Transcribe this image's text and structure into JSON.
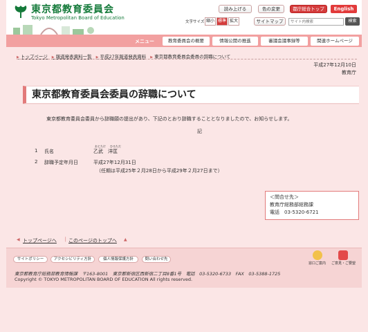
{
  "header": {
    "logo_jp": "東京都教育委員会",
    "logo_en": "Tokyo Metropolitan Board of Education",
    "read_aloud": "読み上げる",
    "color_change": "色の変更",
    "top_page": "都庁総合トップ",
    "english": "English",
    "text_size_label": "文字サイズ",
    "font_small": "縮小",
    "font_standard": "標準",
    "font_large": "拡大",
    "sitemap": "サイトマップ",
    "search_placeholder": "サイト内検索",
    "search_button": "検索"
  },
  "nav": {
    "menu_label": "メニュー",
    "items": [
      "教育委員会の概要",
      "情報公開の推進",
      "審議会議事録等",
      "関連ホームページ"
    ]
  },
  "breadcrumb": [
    "トップページ",
    "報道発表資料一覧",
    "平成27年報道発表資料",
    "東京都教育委員会委員の辞職について"
  ],
  "date_line": "平成27年12月10日",
  "issuer": "教育庁",
  "title": "東京都教育委員会委員の辞職について",
  "body_text": "東京都教育委員会委員から辞職願の提出があり、下記のとおり辞職することとなりましたので、お知らせします。",
  "ki": "記",
  "items": [
    {
      "num": "1",
      "label": "氏名",
      "value": "乙武　洋匡",
      "ruby_surname": "おとたけ",
      "ruby_given": "ひろただ"
    },
    {
      "num": "2",
      "label": "辞職予定年月日",
      "value": "平成27年12月31日",
      "note": "（任期は平成25年２月28日から平成29年２月27日まで）"
    }
  ],
  "contact": {
    "heading": "＜問合せ先＞",
    "dept": "教育庁総務部総務課",
    "phone": "電話　03-5320-6721"
  },
  "page_links": {
    "to_top": "トップページへ",
    "page_top": "このページのトップへ"
  },
  "footer": {
    "links": [
      "サイトポリシー",
      "アクセシビリティ方針",
      "個人情報保護方針",
      "問い合わせ先"
    ],
    "window_label": "窓口ご案内",
    "opinion_label": "ご意見・ご要望",
    "address": "東京都教育庁総務部教育情報課　〒163-8001　東京都新宿区西新宿二丁目8番1号　電話　03-5320-6733　FAX　03-5388-1725",
    "copyright": "Copyright © TOKYO METROPOLITAN BOARD OF EDUCATION All rights reserved."
  },
  "colors": {
    "accent": "#e27b7b",
    "logo_green": "#147a3a",
    "english_red": "#e23b3b"
  }
}
